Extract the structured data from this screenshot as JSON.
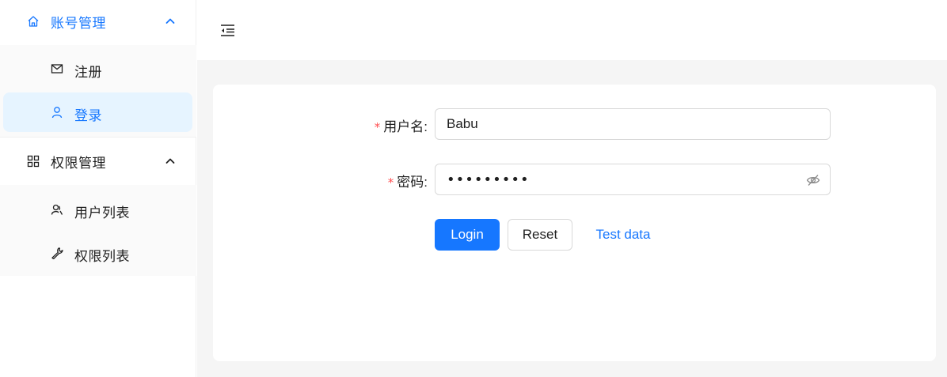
{
  "sidebar": {
    "groups": [
      {
        "title": "账号管理",
        "icon": "home-icon",
        "expanded": true,
        "active": true,
        "items": [
          {
            "label": "注册",
            "icon": "mail-icon",
            "selected": false
          },
          {
            "label": "登录",
            "icon": "user-icon",
            "selected": true
          }
        ]
      },
      {
        "title": "权限管理",
        "icon": "appstore-icon",
        "expanded": true,
        "active": false,
        "items": [
          {
            "label": "用户列表",
            "icon": "team-icon",
            "selected": false
          },
          {
            "label": "权限列表",
            "icon": "wrench-icon",
            "selected": false
          }
        ]
      }
    ]
  },
  "header": {
    "collapse_icon": "menu-fold-icon"
  },
  "form": {
    "username": {
      "label": "用户名",
      "required_mark": "*",
      "colon": ":",
      "value": "Babu"
    },
    "password": {
      "label": "密码",
      "required_mark": "*",
      "colon": ":",
      "masked_value": "•••••••••",
      "visibility_icon": "eye-invisible-icon"
    },
    "buttons": {
      "login": "Login",
      "reset": "Reset",
      "test_data": "Test data"
    }
  },
  "colors": {
    "accent": "#1677ff",
    "selected_bg": "#e6f4ff",
    "required": "#ff4d4f",
    "content_bg": "#f5f5f5"
  }
}
